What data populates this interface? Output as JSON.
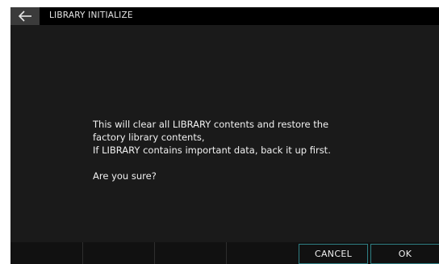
{
  "header": {
    "back_icon": "arrow-left-icon",
    "title": "LIBRARY INITIALIZE"
  },
  "dialog": {
    "line1": "This will clear all LIBRARY contents and restore the",
    "line2": "factory library contents,",
    "line3": "If LIBRARY contains important data, back it up first.",
    "question": "Are you sure?"
  },
  "buttons": {
    "cancel": "CANCEL",
    "ok": "OK"
  },
  "colors": {
    "button_border": "#2f7f84"
  }
}
